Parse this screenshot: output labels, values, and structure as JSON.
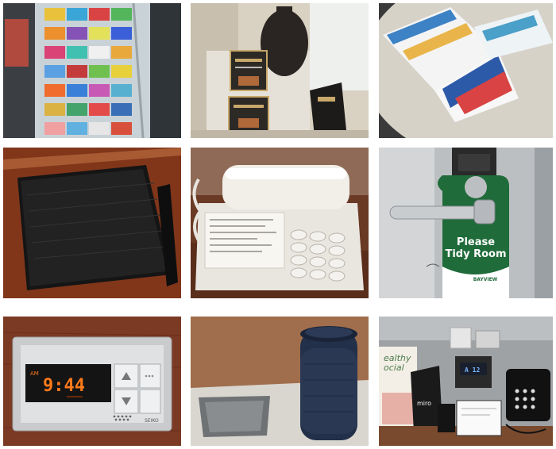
{
  "tiles": [
    {
      "subject": "brochure-rack"
    },
    {
      "subject": "lobby-menu-signs"
    },
    {
      "subject": "leaflets-on-table"
    },
    {
      "subject": "leather-folder"
    },
    {
      "subject": "desk-telephone"
    },
    {
      "subject": "door-hanger"
    },
    {
      "subject": "alarm-clock"
    },
    {
      "subject": "speaker-and-tray"
    },
    {
      "subject": "bedside-table"
    }
  ],
  "door_hanger": {
    "line1": "Please",
    "line2": "Tidy Room",
    "brand": "BAYVIEW"
  },
  "clock": {
    "ampm": "AM",
    "time": "9:44",
    "maker": "SEIKO"
  },
  "bedside": {
    "sign_text": "ealthy\nocial",
    "display_time": "A 12",
    "card_logo": "miro"
  },
  "colors": {
    "wood": "#8a3b1e",
    "hanger_green": "#1f6b3a",
    "clock_digits": "#ff7a1a",
    "speaker": "#23304a"
  }
}
